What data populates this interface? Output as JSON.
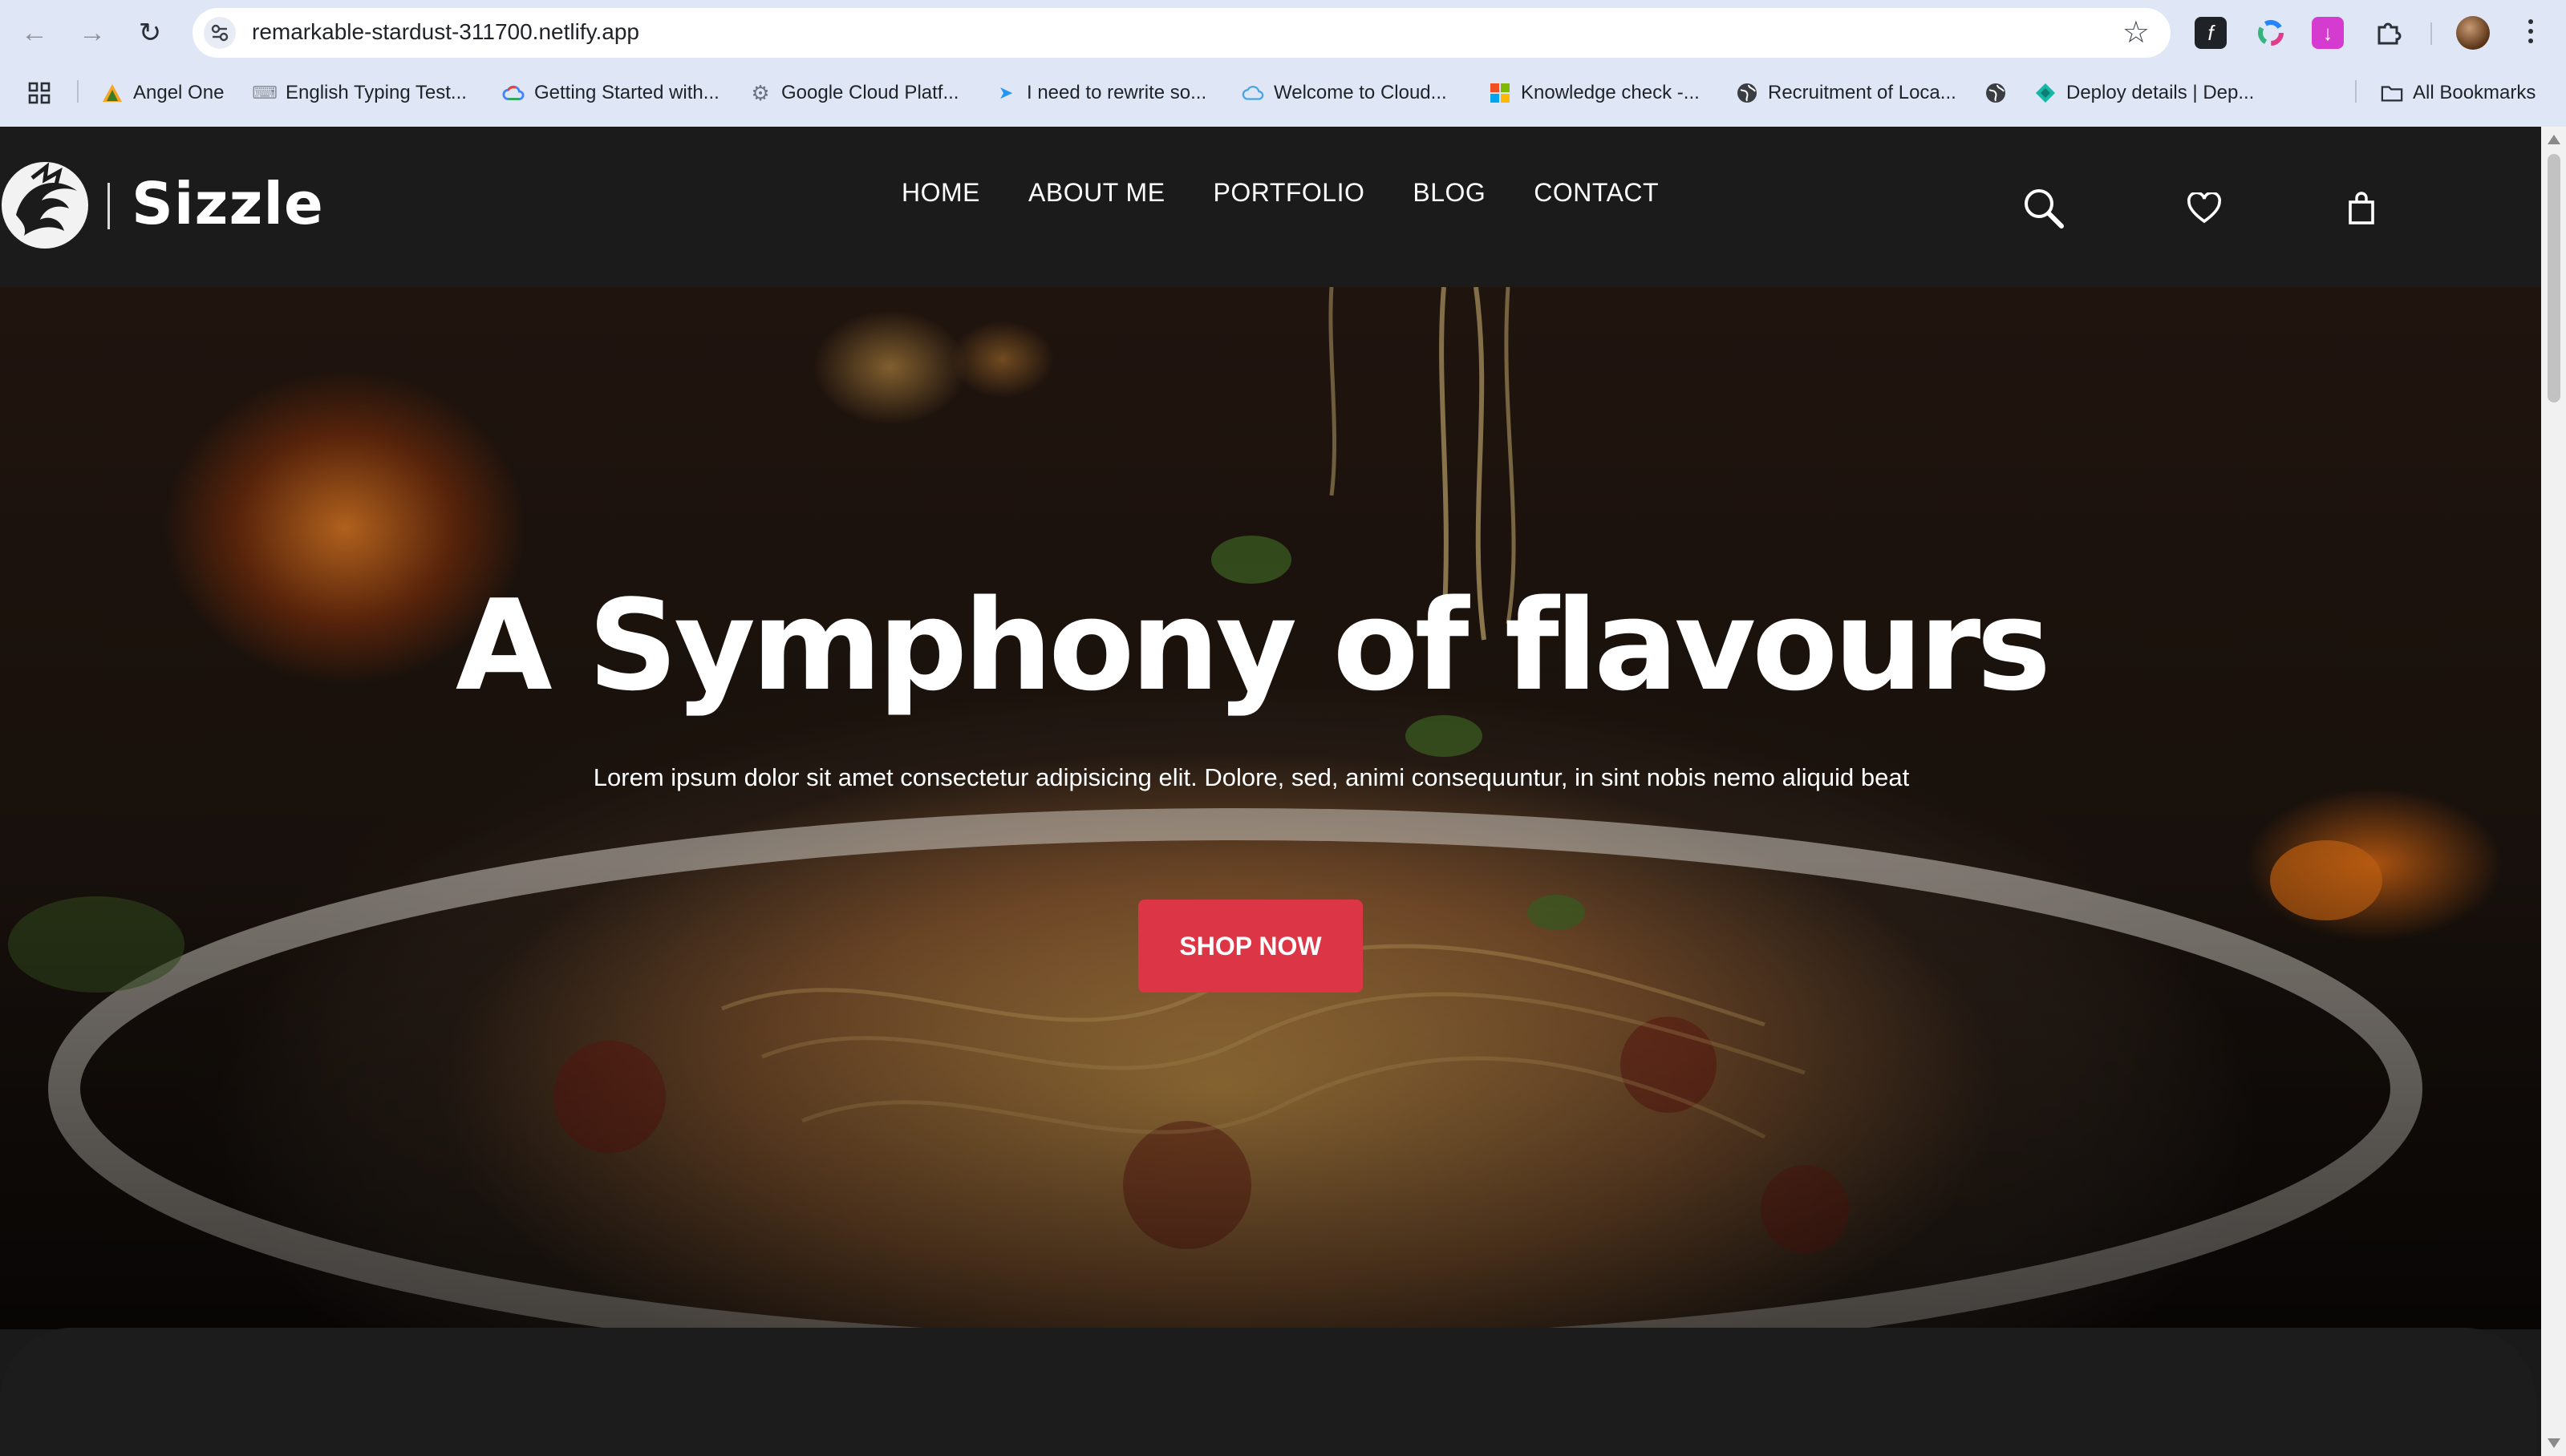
{
  "browser": {
    "url": "remarkable-stardust-311700.netlify.app",
    "bookmarks": [
      {
        "label": "Angel One",
        "icon": "angel-one-icon"
      },
      {
        "label": "English Typing Test...",
        "icon": "typing-test-icon"
      },
      {
        "label": "Getting Started with...",
        "icon": "google-cloud-icon"
      },
      {
        "label": "Google Cloud Platf...",
        "icon": "cloud-platform-icon"
      },
      {
        "label": "I need to rewrite so...",
        "icon": "rewrite-icon"
      },
      {
        "label": "Welcome to Cloud...",
        "icon": "cloud-icon"
      },
      {
        "label": "Knowledge check -...",
        "icon": "microsoft-icon"
      },
      {
        "label": "Recruitment of Loca...",
        "icon": "globe-icon"
      },
      {
        "label": "",
        "icon": "globe-icon"
      },
      {
        "label": "Deploy details | Dep...",
        "icon": "netlify-icon"
      }
    ],
    "all_bookmarks_label": "All Bookmarks"
  },
  "site": {
    "brand": "Sizzle",
    "nav": [
      "HOME",
      "ABOUT ME",
      "PORTFOLIO",
      "BLOG",
      "CONTACT"
    ],
    "header_icons": [
      "search-icon",
      "heart-icon",
      "shopping-bag-icon"
    ]
  },
  "hero": {
    "title": "A Symphony of flavours",
    "subtitle": "Lorem ipsum dolor sit amet consectetur adipisicing elit. Dolore, sed, animi consequuntur, in sint nobis nemo aliquid beat",
    "cta_label": "SHOP NOW"
  },
  "colors": {
    "accent": "#dc3545",
    "header_bg": "#1b1b1b",
    "chrome_bg": "#dfe7f6"
  }
}
